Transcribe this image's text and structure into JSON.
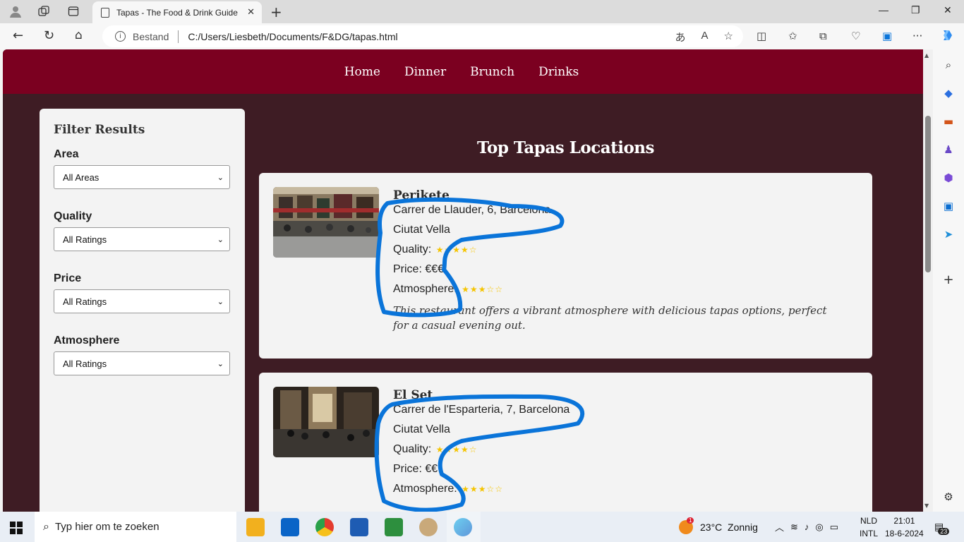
{
  "browser": {
    "tab_title": "Tapas - The Food & Drink Guide",
    "url_label": "Bestand",
    "url": "C:/Users/Liesbeth/Documents/F&DG/tapas.html"
  },
  "site": {
    "nav": [
      "Home",
      "Dinner",
      "Brunch",
      "Drinks"
    ],
    "filter": {
      "title": "Filter Results",
      "groups": [
        {
          "label": "Area",
          "value": "All Areas"
        },
        {
          "label": "Quality",
          "value": "All Ratings"
        },
        {
          "label": "Price",
          "value": "All Ratings"
        },
        {
          "label": "Atmosphere",
          "value": "All Ratings"
        }
      ]
    },
    "title": "Top Tapas Locations",
    "cards": [
      {
        "name": "Perikete",
        "address": "Carrer de Llauder, 6, Barcelona",
        "area": "Ciutat Vella",
        "quality_label": "Quality:",
        "quality_stars": "★★★★☆",
        "price_label": "Price:",
        "price": "€€€",
        "atmosphere_label": "Atmosphere:",
        "atmosphere_stars": "★★★☆☆",
        "description": "This restaurant offers a vibrant atmosphere with delicious tapas options, perfect for a casual evening out."
      },
      {
        "name": "El Set",
        "address": "Carrer de l'Esparteria, 7, Barcelona",
        "area": "Ciutat Vella",
        "quality_label": "Quality:",
        "quality_stars": "★★★★☆",
        "price_label": "Price:",
        "price": "€€",
        "atmosphere_label": "Atmosphere:",
        "atmosphere_stars": "★★★☆☆"
      }
    ]
  },
  "taskbar": {
    "search_placeholder": "Typ hier om te zoeken",
    "weather": "23°C  Zonnig",
    "weather_badge": "1",
    "lang_top": "NLD",
    "lang_bottom": "INTL",
    "time": "21:01",
    "date": "18-6-2024",
    "notif_count": "23"
  },
  "colors": {
    "header": "#7b0020",
    "background": "#3e1c24",
    "card": "#f3f3f3",
    "stars": "#f5c400",
    "annotation": "#0a74d9"
  }
}
